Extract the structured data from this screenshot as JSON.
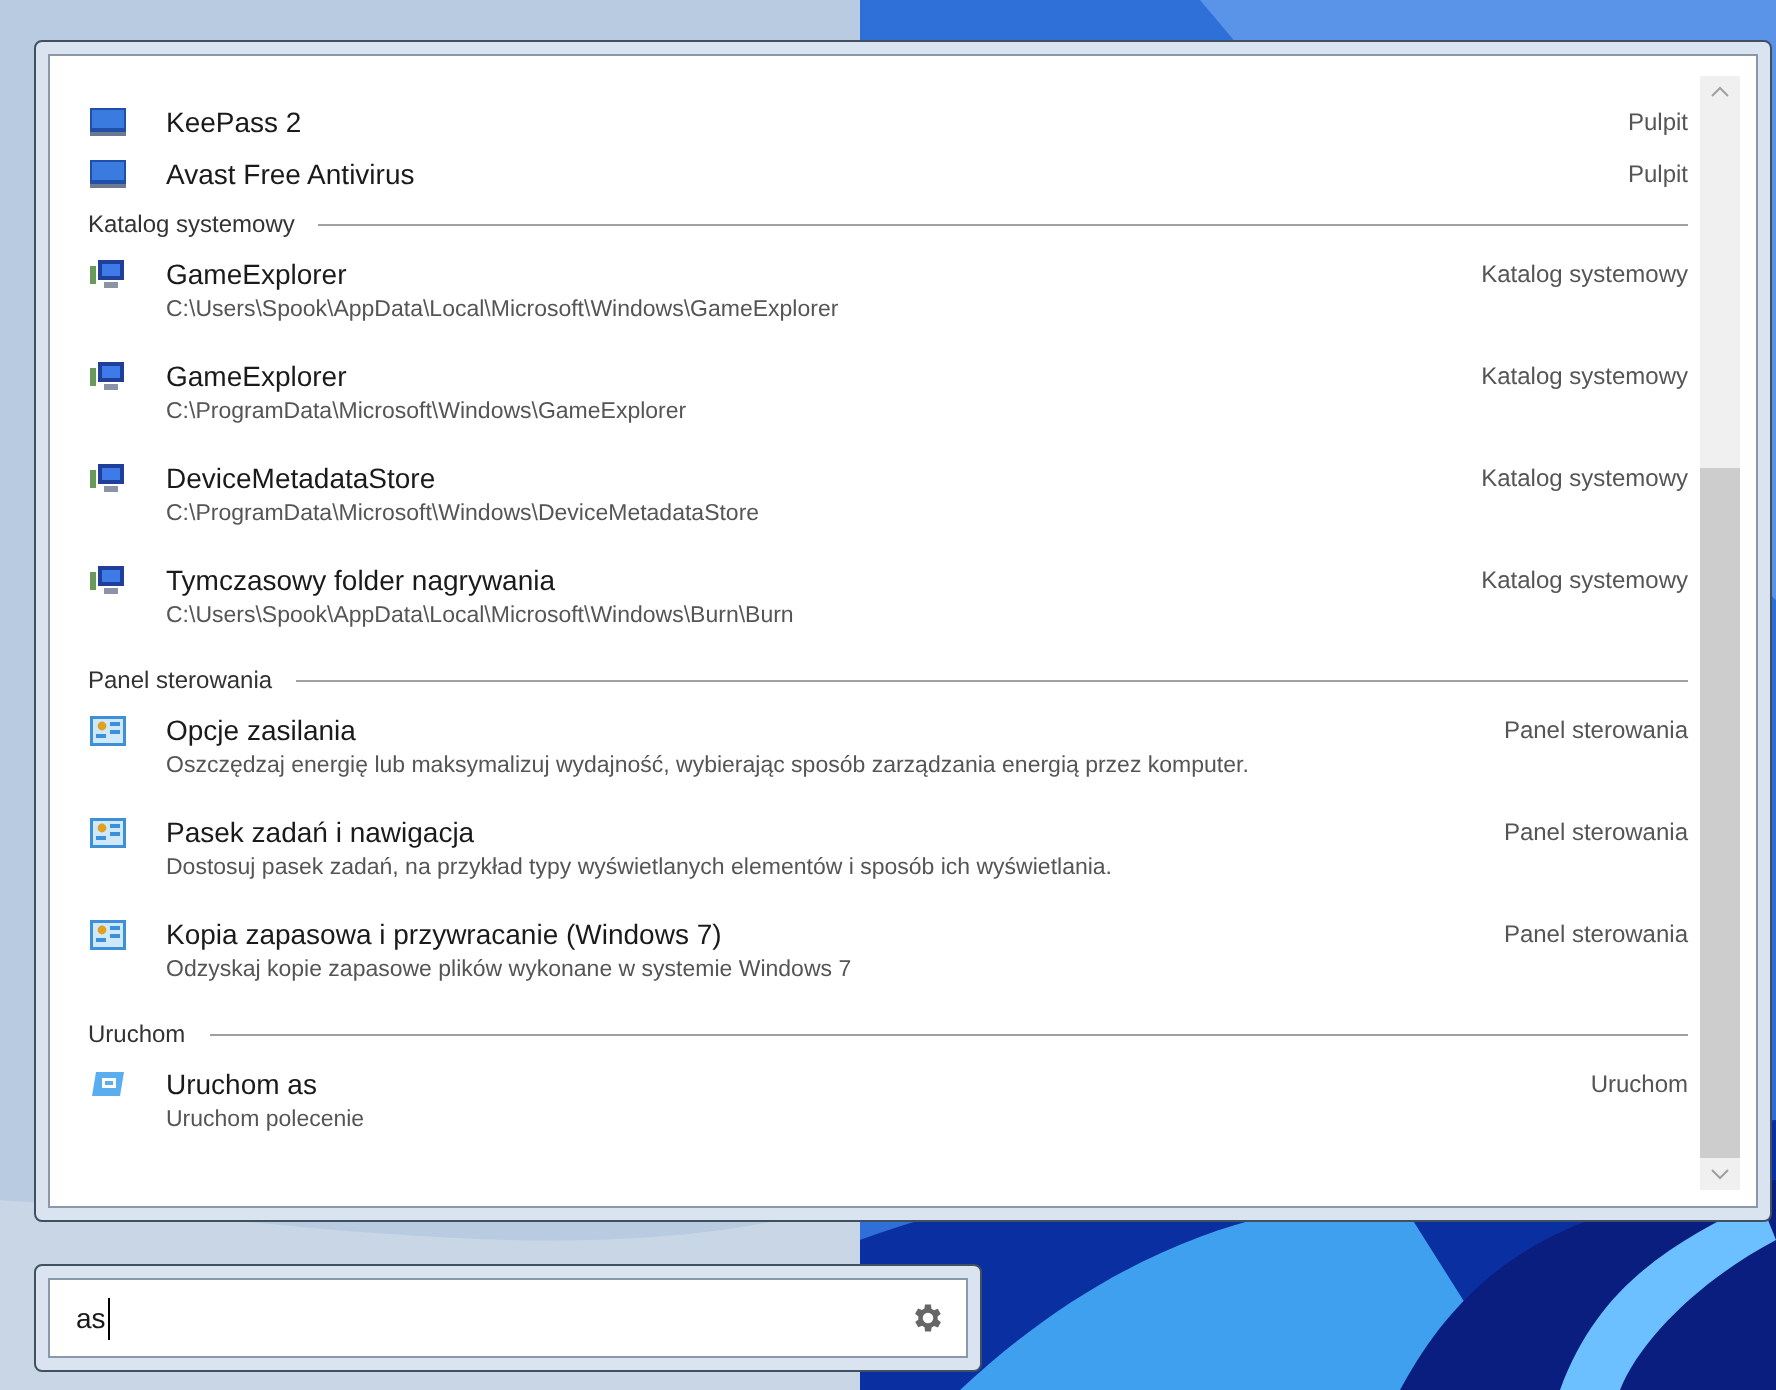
{
  "groups": [
    {
      "items": [
        {
          "kind": "desktop",
          "name": "KeePass 2",
          "category": "Pulpit"
        },
        {
          "kind": "desktop",
          "name": "Avast Free Antivirus",
          "category": "Pulpit"
        }
      ]
    },
    {
      "header": "Katalog systemowy",
      "items": [
        {
          "kind": "folder",
          "name": "GameExplorer",
          "detail": "C:\\Users\\Spook\\AppData\\Local\\Microsoft\\Windows\\GameExplorer",
          "category": "Katalog systemowy"
        },
        {
          "kind": "folder",
          "name": "GameExplorer",
          "detail": "C:\\ProgramData\\Microsoft\\Windows\\GameExplorer",
          "category": "Katalog systemowy"
        },
        {
          "kind": "folder",
          "name": "DeviceMetadataStore",
          "detail": "C:\\ProgramData\\Microsoft\\Windows\\DeviceMetadataStore",
          "category": "Katalog systemowy"
        },
        {
          "kind": "folder",
          "name": "Tymczasowy folder nagrywania",
          "detail": "C:\\Users\\Spook\\AppData\\Local\\Microsoft\\Windows\\Burn\\Burn",
          "category": "Katalog systemowy"
        }
      ]
    },
    {
      "header": "Panel sterowania",
      "items": [
        {
          "kind": "control-panel",
          "name": "Opcje zasilania",
          "detail": "Oszczędzaj energię lub maksymalizuj wydajność, wybierając sposób zarządzania energią przez komputer.",
          "category": "Panel sterowania"
        },
        {
          "kind": "control-panel",
          "name": "Pasek zadań i nawigacja",
          "detail": "Dostosuj pasek zadań, na przykład typy wyświetlanych elementów i sposób ich wyświetlania.",
          "category": "Panel sterowania"
        },
        {
          "kind": "control-panel",
          "name": "Kopia zapasowa i przywracanie (Windows 7)",
          "detail": "Odzyskaj kopie zapasowe plików wykonane w systemie Windows 7",
          "category": "Panel sterowania"
        }
      ]
    },
    {
      "header": "Uruchom",
      "items": [
        {
          "kind": "run",
          "name": "Uruchom as",
          "detail": "Uruchom polecenie",
          "category": "Uruchom"
        }
      ]
    }
  ],
  "search": {
    "value": "as"
  }
}
